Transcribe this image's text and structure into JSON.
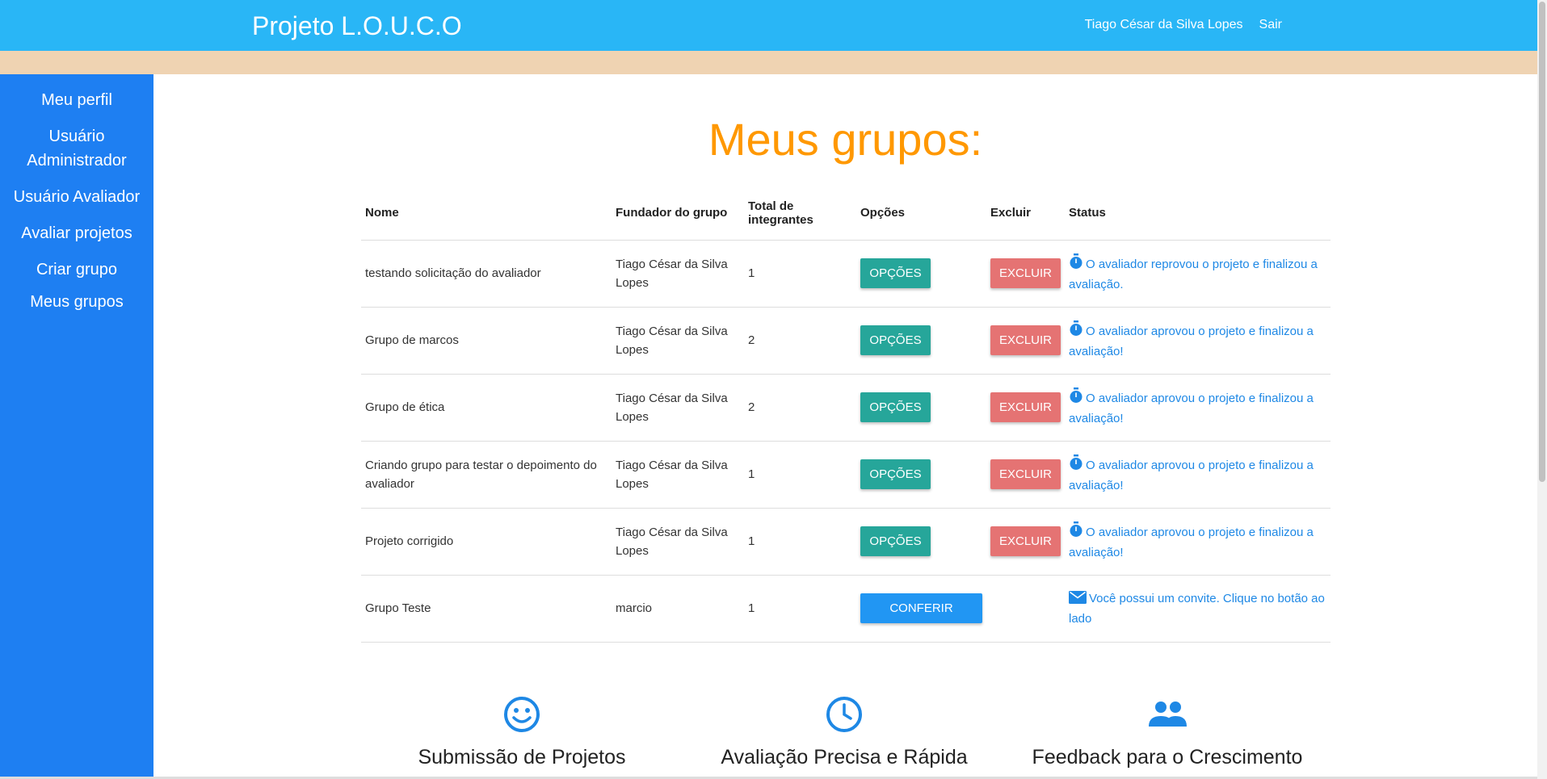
{
  "header": {
    "brand": "Projeto L.O.U.C.O",
    "user_name": "Tiago César da Silva Lopes",
    "logout": "Sair"
  },
  "sidebar": {
    "items": [
      {
        "label": "Meu perfil"
      },
      {
        "label": "Usuário Administrador"
      },
      {
        "label": "Usuário Avaliador"
      },
      {
        "label": "Avaliar projetos"
      },
      {
        "label": "Criar grupo"
      },
      {
        "label": "Meus grupos"
      }
    ]
  },
  "page": {
    "title": "Meus grupos:"
  },
  "table": {
    "headers": {
      "name": "Nome",
      "founder": "Fundador do grupo",
      "members": "Total de integrantes",
      "options": "Opções",
      "delete": "Excluir",
      "status": "Status"
    },
    "rows": [
      {
        "name": "testando solicitação do avaliador",
        "founder": "Tiago César da Silva Lopes",
        "members": "1",
        "opt": "OPÇÕES",
        "del": "EXCLUIR",
        "status": "O avaliador reprovou o projeto e finalizou a avaliação."
      },
      {
        "name": "Grupo de marcos",
        "founder": "Tiago César da Silva Lopes",
        "members": "2",
        "opt": "OPÇÕES",
        "del": "EXCLUIR",
        "status": "O avaliador aprovou o projeto e finalizou a avaliação!"
      },
      {
        "name": "Grupo de ética",
        "founder": "Tiago César da Silva Lopes",
        "members": "2",
        "opt": "OPÇÕES",
        "del": "EXCLUIR",
        "status": "O avaliador aprovou o projeto e finalizou a avaliação!"
      },
      {
        "name": "Criando grupo para testar o depoimento do avaliador",
        "founder": "Tiago César da Silva Lopes",
        "members": "1",
        "opt": "OPÇÕES",
        "del": "EXCLUIR",
        "status": "O avaliador aprovou o projeto e finalizou a avaliação!"
      },
      {
        "name": "Projeto corrigido",
        "founder": "Tiago César da Silva Lopes",
        "members": "1",
        "opt": "OPÇÕES",
        "del": "EXCLUIR",
        "status": "O avaliador aprovou o projeto e finalizou a avaliação!"
      },
      {
        "name": "Grupo Teste",
        "founder": "marcio",
        "members": "1",
        "confirm": "CONFERIR",
        "status": "Você possui um convite. Clique no botão ao lado"
      }
    ]
  },
  "features": [
    {
      "icon": "smile-icon",
      "title": "Submissão de Projetos"
    },
    {
      "icon": "clock-icon",
      "title": "Avaliação Precisa e Rápida"
    },
    {
      "icon": "group-icon",
      "title": "Feedback para o Crescimento"
    }
  ],
  "colors": {
    "header": "#29b6f6",
    "sidebar": "#1e7ff2",
    "accent_title": "#ff9800",
    "options_button": "#26a69a",
    "delete_button": "#e57373",
    "confirm_button": "#2196f3",
    "status_text": "#1e88e5"
  }
}
